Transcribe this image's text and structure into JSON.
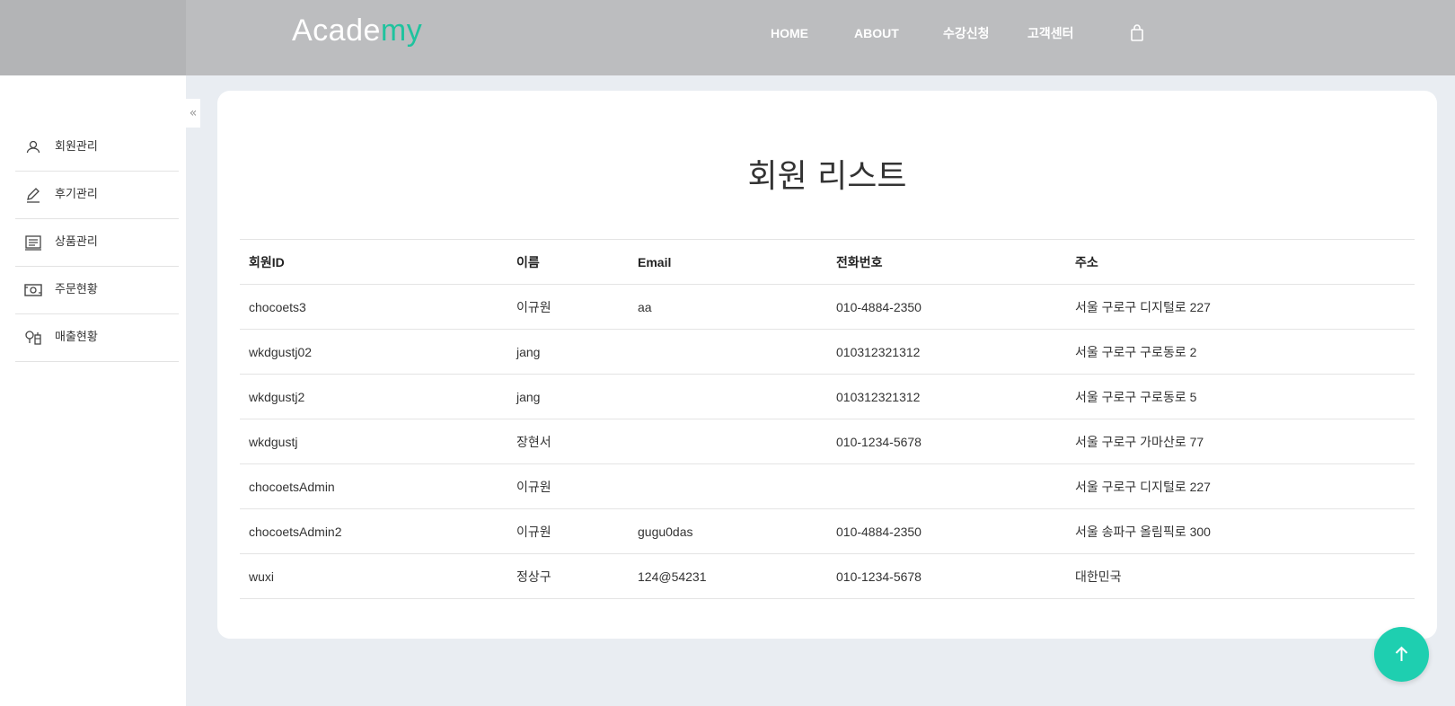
{
  "brand": {
    "logo_main": "Acade",
    "logo_accent": "my",
    "accent_color": "#1fc39e"
  },
  "nav": {
    "home": "HOME",
    "about": "ABOUT",
    "enroll": "수강신청",
    "support": "고객센터",
    "bag_icon": "shopping-bag-icon"
  },
  "sidebar": {
    "collapse_glyph": "«",
    "items": [
      {
        "label": "회원관리",
        "icon": "user-icon"
      },
      {
        "label": "후기관리",
        "icon": "pencil-icon"
      },
      {
        "label": "상품관리",
        "icon": "list-board-icon"
      },
      {
        "label": "주문현황",
        "icon": "money-icon"
      },
      {
        "label": "매출현황",
        "icon": "chart-bulb-icon"
      }
    ]
  },
  "main": {
    "title": "회원 리스트",
    "columns": [
      "회원ID",
      "이름",
      "Email",
      "전화번호",
      "주소"
    ],
    "rows": [
      [
        "chocoets3",
        "이규원",
        "aa",
        "010-4884-2350",
        "서울 구로구 디지털로 227"
      ],
      [
        "wkdgustj02",
        "jang",
        "",
        "010312321312",
        "서울 구로구 구로동로 2"
      ],
      [
        "wkdgustj2",
        "jang",
        "",
        "010312321312",
        "서울 구로구 구로동로 5"
      ],
      [
        "wkdgustj",
        "장현서",
        "",
        "010-1234-5678",
        "서울 구로구 가마산로 77"
      ],
      [
        "chocoetsAdmin",
        "이규원",
        "",
        "",
        "서울 구로구 디지털로 227"
      ],
      [
        "chocoetsAdmin2",
        "이규원",
        "gugu0das",
        "010-4884-2350",
        "서울 송파구 올림픽로 300"
      ],
      [
        "wuxi",
        "정상구",
        "124@54231",
        "010-1234-5678",
        "대한민국"
      ]
    ]
  },
  "scroll_top": {
    "icon": "arrow-up-icon",
    "color": "#1ecfb0"
  }
}
